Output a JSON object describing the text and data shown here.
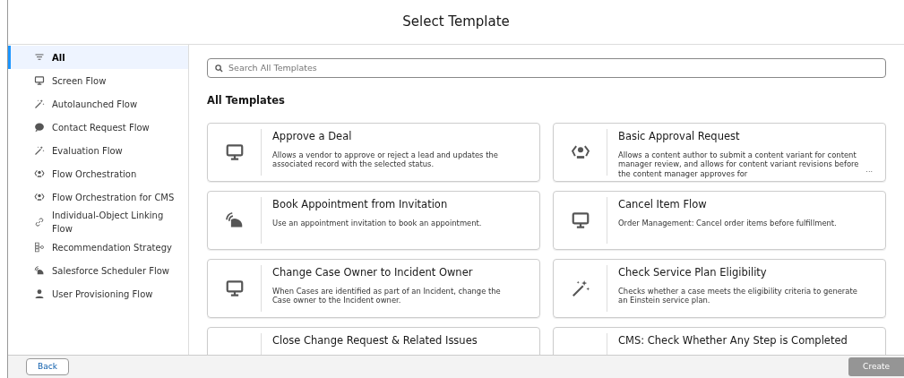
{
  "title": "Select Template",
  "sidebar": {
    "items": [
      {
        "label": "All",
        "kind": "filter",
        "selected": true
      },
      {
        "label": "Screen Flow",
        "kind": "monitor",
        "selected": false
      },
      {
        "label": "Autolaunched Flow",
        "kind": "wand",
        "selected": false
      },
      {
        "label": "Contact Request Flow",
        "kind": "chat",
        "selected": false
      },
      {
        "label": "Evaluation Flow",
        "kind": "wand",
        "selected": false
      },
      {
        "label": "Flow Orchestration",
        "kind": "orchestration",
        "selected": false
      },
      {
        "label": "Flow Orchestration for CMS",
        "kind": "orchestration",
        "selected": false
      },
      {
        "label": "Individual-Object Linking Flow",
        "kind": "link",
        "selected": false
      },
      {
        "label": "Recommendation Strategy",
        "kind": "strategy",
        "selected": false
      },
      {
        "label": "Salesforce Scheduler Flow",
        "kind": "scheduler",
        "selected": false
      },
      {
        "label": "User Provisioning Flow",
        "kind": "user",
        "selected": false
      }
    ]
  },
  "search": {
    "placeholder": "Search All Templates"
  },
  "section_title": "All Templates",
  "templates": [
    {
      "title": "Approve a Deal",
      "description": "Allows a vendor to approve or reject a lead and updates the associated record with the selected status.",
      "kind": "monitor"
    },
    {
      "title": "Basic Approval Request",
      "description": "Allows a content author to submit a content variant for content manager review, and allows for content variant revisions before the content manager approves for",
      "more": "...",
      "kind": "orchestration"
    },
    {
      "title": "Book Appointment from Invitation",
      "description": "Use an appointment invitation to book an appointment.",
      "kind": "scheduler"
    },
    {
      "title": "Cancel Item Flow",
      "description": "Order Management: Cancel order items before fulfillment.",
      "kind": "monitor"
    },
    {
      "title": "Change Case Owner to Incident Owner",
      "description": "When Cases are identified as part of an Incident, change the Case owner to the Incident owner.",
      "kind": "monitor"
    },
    {
      "title": "Check Service Plan Eligibility",
      "description": "Checks whether a case meets the eligibility criteria to generate an Einstein service plan.",
      "kind": "wand"
    },
    {
      "title": "Close Change Request & Related Issues",
      "kind": "none"
    },
    {
      "title": "CMS: Check Whether Any Step is Completed",
      "kind": "none"
    }
  ],
  "buttons": {
    "back": "Back",
    "create": {
      "label": "Create",
      "disabled": true
    }
  }
}
